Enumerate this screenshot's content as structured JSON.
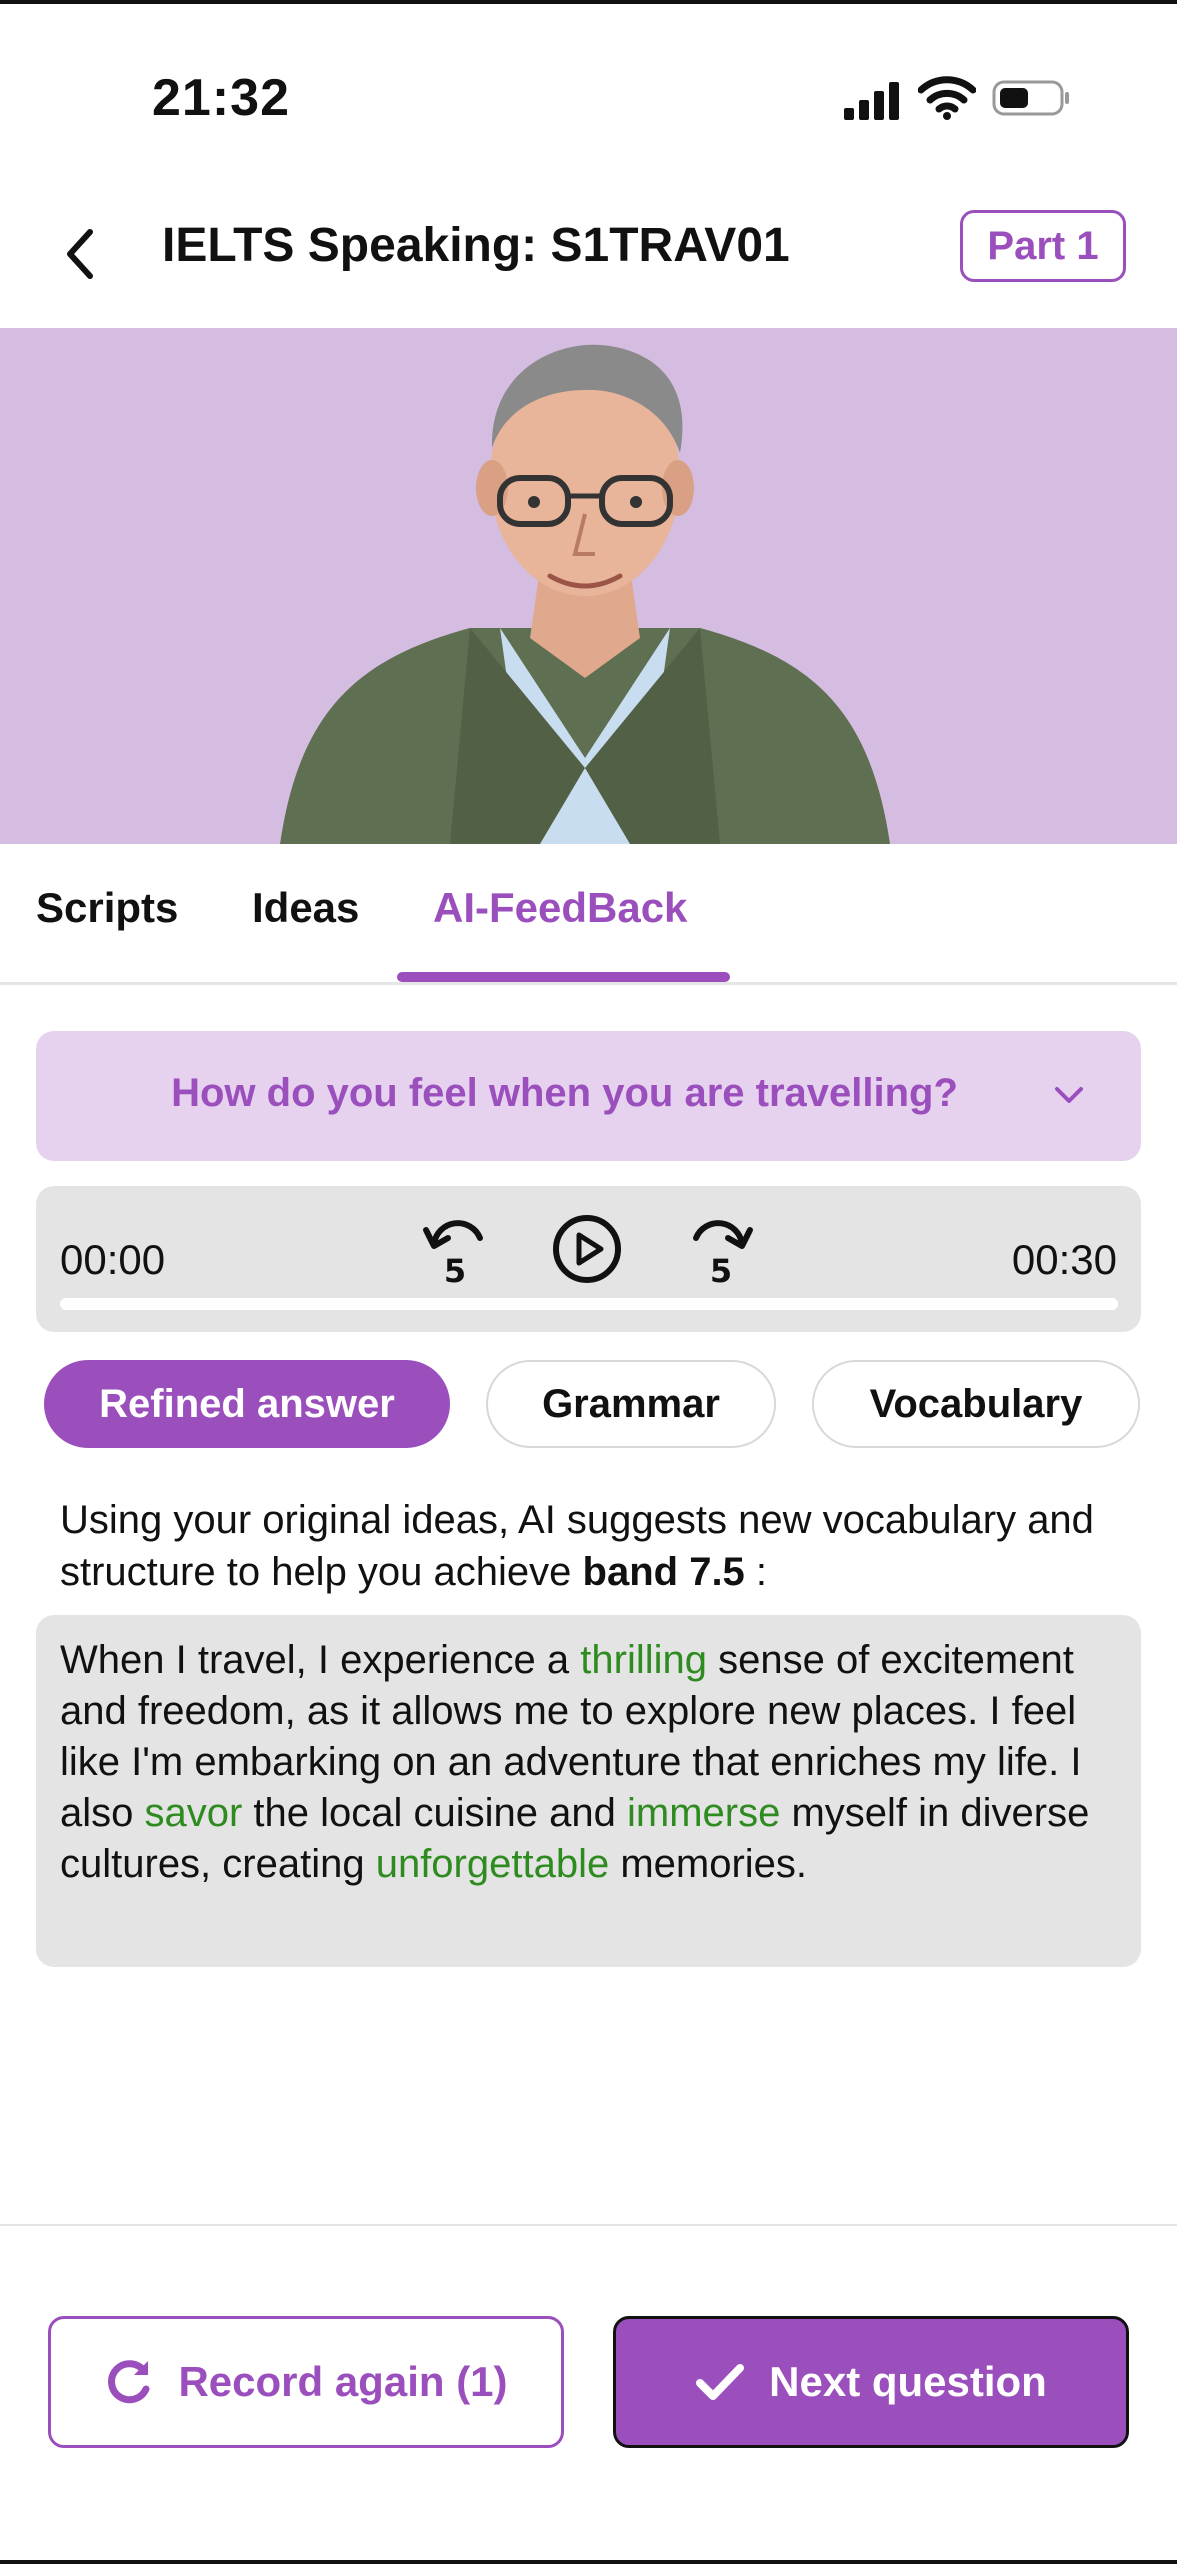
{
  "status_bar": {
    "time": "21:32"
  },
  "header": {
    "title": "IELTS Speaking: S1TRAV01",
    "part_label": "Part 1"
  },
  "tabs": [
    {
      "label": "Scripts",
      "active": false
    },
    {
      "label": "Ideas",
      "active": false
    },
    {
      "label": "AI-FeedBack",
      "active": true
    }
  ],
  "question": {
    "text": "How do you feel when you are travelling?"
  },
  "player": {
    "current_time": "00:00",
    "total_time": "00:30",
    "skip_seconds": "5",
    "progress": 0
  },
  "answer_tabs": [
    {
      "label": "Refined answer",
      "active": true
    },
    {
      "label": "Grammar",
      "active": false
    },
    {
      "label": "Vocabulary",
      "active": false
    }
  ],
  "intro": {
    "text": "Using your original ideas, AI suggests new vocabulary and structure to help you achieve",
    "band": "band 7.5",
    "suffix": ":"
  },
  "answer": {
    "segments": [
      {
        "text": "When I travel, I experience a ",
        "highlight": false
      },
      {
        "text": "thrilling",
        "highlight": true
      },
      {
        "text": " sense of excitement and freedom, as it allows me to explore new places. I feel like I'm embarking on an adventure that enriches my life. I also ",
        "highlight": false
      },
      {
        "text": "savor",
        "highlight": true
      },
      {
        "text": " the local cuisine and ",
        "highlight": false
      },
      {
        "text": "immerse",
        "highlight": true
      },
      {
        "text": " myself in diverse cultures, creating ",
        "highlight": false
      },
      {
        "text": "unforgettable",
        "highlight": true
      },
      {
        "text": " memories.",
        "highlight": false
      }
    ]
  },
  "buttons": {
    "record_again": "Record again (1)",
    "next_question": "Next question"
  },
  "colors": {
    "accent": "#9a4fbd",
    "highlight": "#2e8b1f",
    "hero_bg": "#d4bde0",
    "question_bg": "#e6d2ef"
  },
  "icons": [
    "back-arrow-icon",
    "signal-icon",
    "wifi-icon",
    "battery-icon",
    "chevron-down-icon",
    "rewind-5-icon",
    "play-icon",
    "forward-5-icon",
    "refresh-icon",
    "checkmark-icon"
  ]
}
